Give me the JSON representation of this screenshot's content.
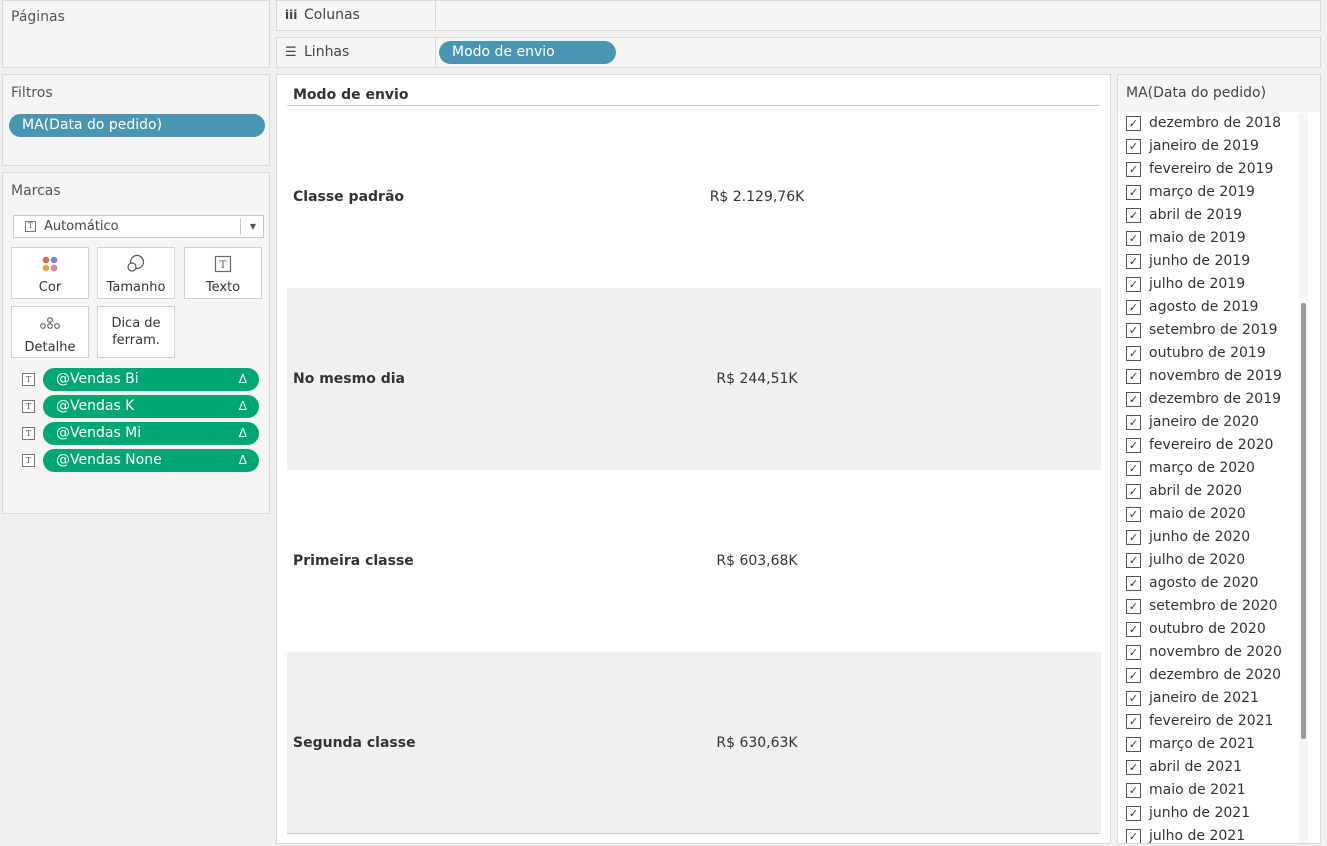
{
  "pages_panel": {
    "title": "Páginas"
  },
  "filters_panel": {
    "title": "Filtros",
    "pill": "MA(Data do pedido)"
  },
  "marks_panel": {
    "title": "Marcas",
    "mark_type": "Automático",
    "buttons": {
      "color": "Cor",
      "size": "Tamanho",
      "text": "Texto",
      "detail": "Detalhe",
      "tooltip_line1": "Dica de",
      "tooltip_line2": "ferram."
    },
    "fields": [
      {
        "label": "@Vendas Bi",
        "badge": "Δ"
      },
      {
        "label": "@Vendas K",
        "badge": "Δ"
      },
      {
        "label": "@Vendas Mi",
        "badge": "Δ"
      },
      {
        "label": "@Vendas None",
        "badge": "Δ"
      }
    ]
  },
  "shelves": {
    "columns": {
      "label": "Colunas",
      "icon": "iii"
    },
    "rows": {
      "label": "Linhas",
      "icon": "☰",
      "pill": "Modo de envio"
    }
  },
  "view": {
    "column_header": "Modo de envio",
    "rows": [
      {
        "label": "Classe padrão",
        "value": "R$ 2.129,76K"
      },
      {
        "label": "No mesmo dia",
        "value": "R$ 244,51K"
      },
      {
        "label": "Primeira classe",
        "value": "R$ 603,68K"
      },
      {
        "label": "Segunda classe",
        "value": "R$ 630,63K"
      }
    ]
  },
  "filter_card": {
    "title": "MA(Data do pedido)",
    "items": [
      "dezembro de 2018",
      "janeiro de 2019",
      "fevereiro de 2019",
      "março de 2019",
      "abril de 2019",
      "maio de 2019",
      "junho de 2019",
      "julho de 2019",
      "agosto de 2019",
      "setembro de 2019",
      "outubro de 2019",
      "novembro de 2019",
      "dezembro de 2019",
      "janeiro de 2020",
      "fevereiro de 2020",
      "março de 2020",
      "abril de 2020",
      "maio de 2020",
      "junho de 2020",
      "julho de 2020",
      "agosto de 2020",
      "setembro de 2020",
      "outubro de 2020",
      "novembro de 2020",
      "dezembro de 2020",
      "janeiro de 2021",
      "fevereiro de 2021",
      "março de 2021",
      "abril de 2021",
      "maio de 2021",
      "junho de 2021",
      "julho de 2021"
    ],
    "checked": true
  },
  "colors": {
    "pill_blue": "#4996b2",
    "pill_green": "#00a772",
    "row_shade": "#f0f0f0"
  }
}
